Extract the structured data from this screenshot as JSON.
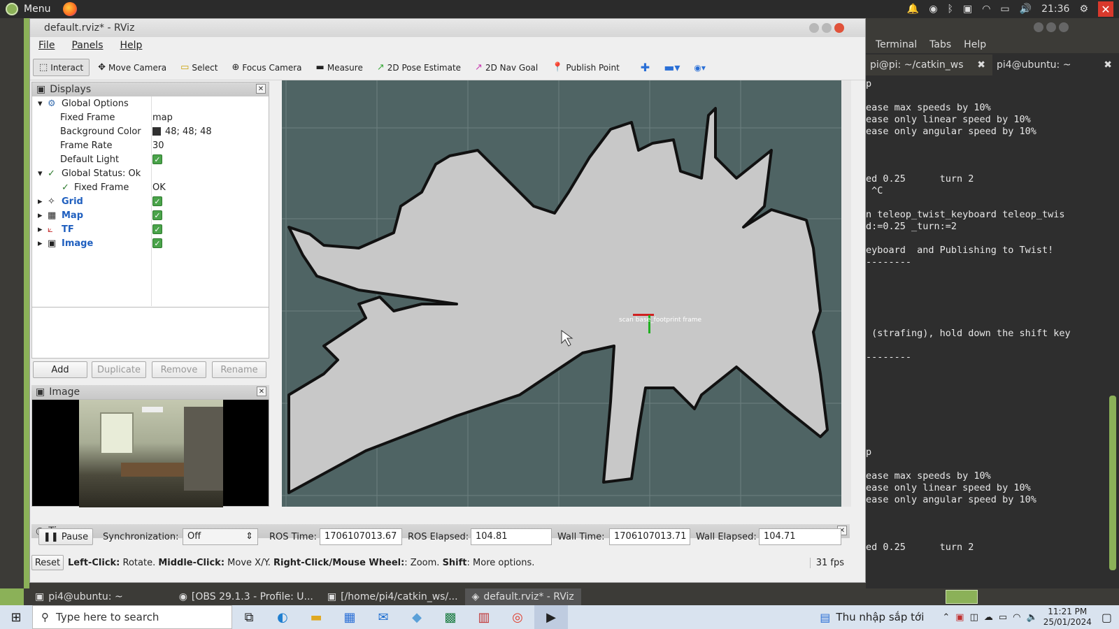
{
  "topbar": {
    "menu_label": "Menu",
    "clock": "21:36"
  },
  "rviz": {
    "title": "default.rviz* - RViz",
    "menu": [
      "File",
      "Panels",
      "Help"
    ],
    "toolbar": [
      {
        "label": "Interact",
        "icon": "cursor-icon"
      },
      {
        "label": "Move Camera",
        "icon": "move-icon"
      },
      {
        "label": "Select",
        "icon": "select-icon"
      },
      {
        "label": "Focus Camera",
        "icon": "focus-icon"
      },
      {
        "label": "Measure",
        "icon": "ruler-icon"
      },
      {
        "label": "2D Pose Estimate",
        "icon": "green-arrow-icon"
      },
      {
        "label": "2D Nav Goal",
        "icon": "pink-arrow-icon"
      },
      {
        "label": "Publish Point",
        "icon": "pin-icon"
      }
    ],
    "displays": {
      "title": "Displays",
      "global_options": "Global Options",
      "fixed_frame_label": "Fixed Frame",
      "fixed_frame_value": "map",
      "bg_color_label": "Background Color",
      "bg_color_value": "48; 48; 48",
      "frame_rate_label": "Frame Rate",
      "frame_rate_value": "30",
      "default_light_label": "Default Light",
      "global_status": "Global Status: Ok",
      "fixed_frame_status_label": "Fixed Frame",
      "fixed_frame_status_value": "OK",
      "items": [
        "Grid",
        "Map",
        "TF",
        "Image"
      ]
    },
    "buttons": {
      "add": "Add",
      "duplicate": "Duplicate",
      "remove": "Remove",
      "rename": "Rename"
    },
    "image_panel": {
      "title": "Image"
    },
    "map_label": "scan base_footprint frame",
    "time": {
      "title": "Time",
      "pause": "Pause",
      "sync_label": "Synchronization:",
      "sync_value": "Off",
      "ros_time_label": "ROS Time:",
      "ros_time": "1706107013.67",
      "ros_elapsed_label": "ROS Elapsed:",
      "ros_elapsed": "104.81",
      "wall_time_label": "Wall Time:",
      "wall_time": "1706107013.71",
      "wall_elapsed_label": "Wall Elapsed:",
      "wall_elapsed": "104.71"
    },
    "status": {
      "reset": "Reset",
      "help_left": "Left-Click:",
      "help_left_v": " Rotate. ",
      "help_mid": "Middle-Click:",
      "help_mid_v": " Move X/Y. ",
      "help_right": "Right-Click/Mouse Wheel:",
      "help_right_v": ": Zoom. ",
      "help_shift": "Shift",
      "help_shift_v": ": More options.",
      "fps": "31 fps"
    }
  },
  "terminal": {
    "menu": [
      "Terminal",
      "Tabs",
      "Help"
    ],
    "tabs": [
      "pi@pi: ~/catkin_ws",
      "pi4@ubuntu: ~"
    ],
    "lines": [
      "p",
      "",
      "ease max speeds by 10%",
      "ease only linear speed by 10%",
      "ease only angular speed by 10%",
      "",
      "",
      "",
      "ed 0.25      turn 2",
      " ^C",
      "",
      "n teleop_twist_keyboard teleop_twis",
      "d:=0.25 _turn:=2",
      "",
      "eyboard  and Publishing to Twist!",
      "--------",
      "",
      "",
      "",
      "",
      "",
      " (strafing), hold down the shift key",
      "",
      "--------",
      "",
      "",
      "",
      "",
      "",
      "",
      "",
      "p",
      "",
      "ease max speeds by 10%",
      "ease only linear speed by 10%",
      "ease only angular speed by 10%",
      "",
      "",
      "",
      "ed 0.25      turn 2"
    ]
  },
  "mint_panel": {
    "tasks": [
      "pi4@ubuntu: ~",
      "[OBS 29.1.3 - Profile: U...",
      "[/home/pi4/catkin_ws/...",
      "default.rviz* - RViz"
    ]
  },
  "windows": {
    "search_placeholder": "Type here to search",
    "news": "Thu nhập sắp tới",
    "time": "11:21 PM",
    "date": "25/01/2024"
  }
}
